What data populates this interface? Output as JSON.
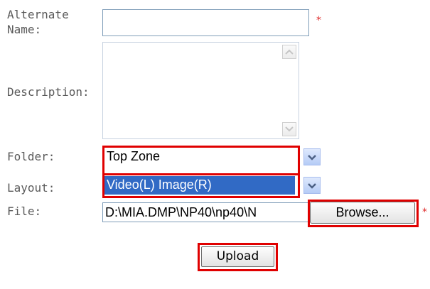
{
  "form": {
    "alt_name": {
      "label_line1": "Alternate",
      "label_line2": "Name:",
      "value": "",
      "required_mark": "*"
    },
    "description": {
      "label": "Description:",
      "value": ""
    },
    "folder": {
      "label": "Folder:",
      "selected": "Top Zone"
    },
    "layout": {
      "label": "Layout:",
      "selected": "Video(L) Image(R)"
    },
    "file": {
      "label": "File:",
      "path": "D:\\MIA.DMP\\NP40\\np40\\N",
      "browse_label": "Browse...",
      "required_mark": "*"
    },
    "upload_label": "Upload"
  },
  "colors": {
    "highlight": "#e00000",
    "selection": "#316ac5",
    "field_border": "#7f9db9",
    "required": "#e03030"
  },
  "icons": {
    "dropdown": "chevron-down-icon",
    "scroll_up": "scroll-up-arrow-icon",
    "scroll_down": "scroll-down-arrow-icon"
  }
}
